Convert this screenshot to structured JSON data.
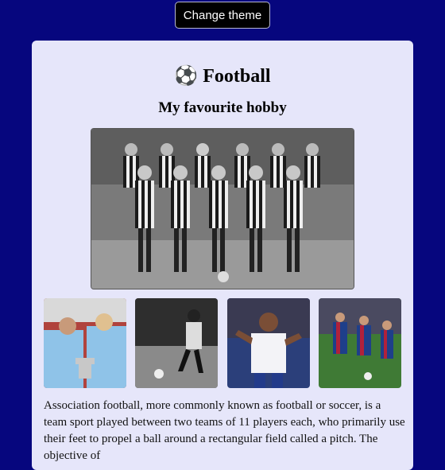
{
  "header": {
    "theme_button_label": "Change theme"
  },
  "main": {
    "title_icon": "⚽",
    "title": "Football",
    "subtitle": "My favourite hobby",
    "paragraph": "Association football, more commonly known as football or soccer, is a team sport played between two teams of 11 players each, who primarily use their feet to propel a ball around a rectangular field called a pitch. The objective of"
  },
  "icons": {
    "title_icon": "soccer-ball-icon"
  },
  "colors": {
    "background": "#06067e",
    "card": "#e6e6fa",
    "button": "#000000"
  }
}
